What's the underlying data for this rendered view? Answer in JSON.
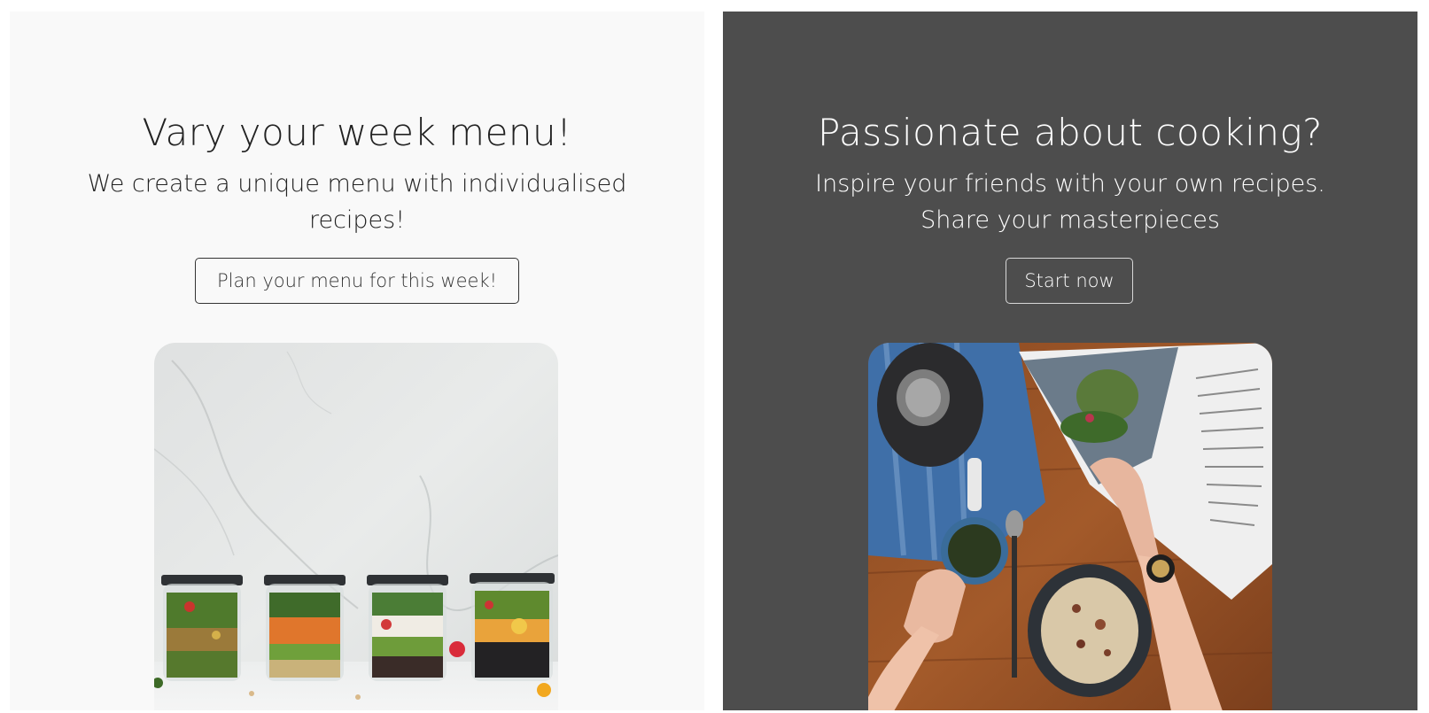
{
  "left_card": {
    "title": "Vary your week menu!",
    "subtitle": "We create a unique menu with individualised recipes!",
    "button_label": "Plan your menu for this week!",
    "image": "meal-prep-jars-photo"
  },
  "right_card": {
    "title": "Passionate about cooking?",
    "subtitle_line1": "Inspire your friends with your own recipes.",
    "subtitle_line2": "Share your masterpieces",
    "button_label": "Start now",
    "image": "cooking-table-magazine-photo"
  },
  "colors": {
    "left_background": "#f9f9f9",
    "right_background": "#4d4d4d",
    "left_text": "#222222",
    "right_text": "#ffffff"
  }
}
